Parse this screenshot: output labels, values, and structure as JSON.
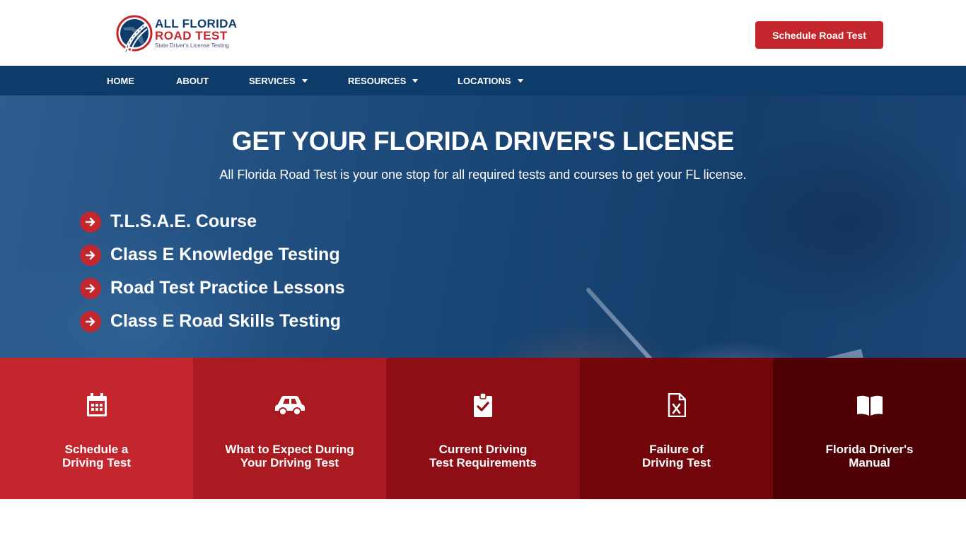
{
  "header": {
    "logo": {
      "line1": "ALL FLORIDA",
      "line2": "ROAD TEST",
      "tagline": "State Driver's License Testing"
    },
    "cta_label": "Schedule Road Test"
  },
  "nav": {
    "items": [
      {
        "label": "HOME",
        "has_dropdown": false
      },
      {
        "label": "ABOUT",
        "has_dropdown": false
      },
      {
        "label": "SERVICES",
        "has_dropdown": true
      },
      {
        "label": "RESOURCES",
        "has_dropdown": true
      },
      {
        "label": "LOCATIONS",
        "has_dropdown": true
      }
    ]
  },
  "hero": {
    "title": "GET YOUR FLORIDA DRIVER'S LICENSE",
    "subtitle": "All Florida Road Test is your one stop for all required tests and courses to get your FL license.",
    "features": [
      {
        "icon": "arrow-circle-right-icon",
        "label": "T.L.S.A.E. Course"
      },
      {
        "icon": "arrow-circle-right-icon",
        "label": "Class E Knowledge Testing"
      },
      {
        "icon": "arrow-circle-right-icon",
        "label": "Road Test Practice Lessons"
      },
      {
        "icon": "arrow-circle-right-icon",
        "label": "Class E Road Skills Testing"
      }
    ]
  },
  "tiles": [
    {
      "icon": "calendar-icon",
      "label": "Schedule a\nDriving Test",
      "color": "#c4262e"
    },
    {
      "icon": "car-icon",
      "label": "What to Expect During\nYour Driving Test",
      "color": "#a91a21"
    },
    {
      "icon": "clipboard-check-icon",
      "label": "Current Driving\nTest Requirements",
      "color": "#8d0e14"
    },
    {
      "icon": "file-excel-icon",
      "label": "Failure of\nDriving Test",
      "color": "#72060b"
    },
    {
      "icon": "book-open-icon",
      "label": "Florida Driver's\nManual",
      "color": "#4e0004"
    }
  ],
  "colors": {
    "brand_red": "#c4262e",
    "brand_navy": "#0e3c6a"
  }
}
